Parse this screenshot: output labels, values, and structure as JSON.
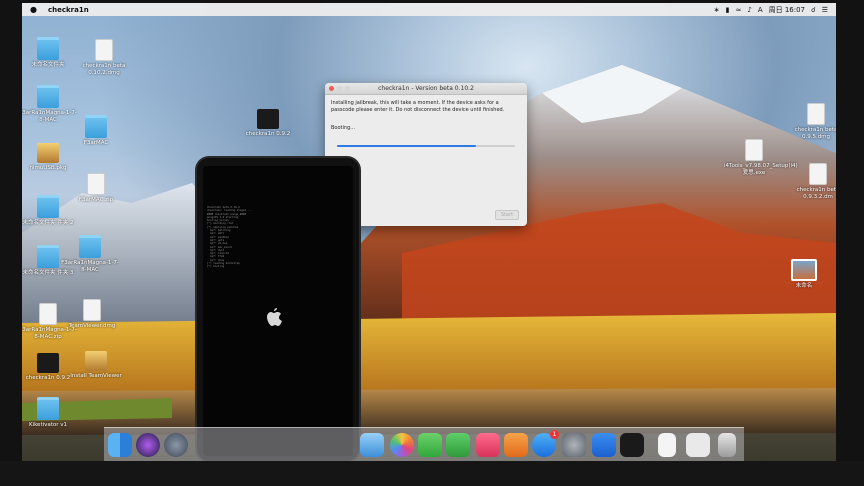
{
  "menubar": {
    "apple": "",
    "app_name": "checkra1n",
    "clock": "周日 16:07",
    "status_icons": [
      "bluetooth-icon",
      "battery-icon",
      "wifi-icon",
      "volume-icon",
      "input-source-icon"
    ]
  },
  "desktop_icons": [
    {
      "label": "未命名文件夹",
      "type": "folder"
    },
    {
      "label": "checkra1n beta 0.10.2.dmg",
      "type": "doc"
    },
    {
      "label": "F3arRa1nMagna-1-7-8-MAC",
      "type": "folder"
    },
    {
      "label": "F3arMAC",
      "type": "folder"
    },
    {
      "label": "checkra1n 0.9.2",
      "type": "app"
    },
    {
      "label": "nimuUSB.pkg",
      "type": "pkg"
    },
    {
      "label": "F3arMAC.zip",
      "type": "doc"
    },
    {
      "label": "未命名文件夹 件夹 2",
      "type": "folder"
    },
    {
      "label": "未命名文件夹 件夹 3",
      "type": "folder"
    },
    {
      "label": "F3arRa1nMagna-1-7-8-MAC",
      "type": "folder"
    },
    {
      "label": "TeamViewer.dmg",
      "type": "doc"
    },
    {
      "label": "F3arRa1nMagna-1-7-8-MAC.zip",
      "type": "doc"
    },
    {
      "label": "checkra1n 0.9.2",
      "type": "app"
    },
    {
      "label": "Install TeamViewer",
      "type": "pkg"
    },
    {
      "label": "Kiketivator v1",
      "type": "folder"
    },
    {
      "label": "checkra1n beta 0.9.5.dmg",
      "type": "doc"
    },
    {
      "label": "i4Tools_v7.98.07_Setup(i4)爱思.exe",
      "type": "doc"
    },
    {
      "label": "checkra1n beta 0.9.3.2.dm",
      "type": "doc"
    },
    {
      "label": "未命名",
      "type": "image"
    }
  ],
  "checkra1n_window": {
    "title": "checkra1n - Version beta 0.10.2",
    "message": "Installing jailbreak, this will take a moment. If the device asks for a passcode please enter it. Do not disconnect the device until finished.",
    "status": "Booting...",
    "progress": 0.78,
    "button_label": "Start"
  },
  "phone": {
    "log_lines": [
      "Checkra1n beta 0.10.2",
      "checkra1n: loading stage2 ...",
      "#### checkra1n pongo ####",
      "pongoOS 2.0 starting",
      "booting kernel ...",
      "[*] mounting root",
      "[*] applying patches",
      "  kpf: patching",
      "  kpf: amfi",
      "  kpf: sandbox",
      "  kpf: apfs",
      "  kpf: vm_map",
      "  kpf: mac_mount",
      "  kpf: dyld",
      "  kpf: launchd",
      "  kpf: tfp0",
      "  kpf: done",
      "[*] loading bootstrap",
      "[*] booting"
    ]
  },
  "dock": {
    "items": [
      "finder-icon",
      "siri-icon",
      "launchpad-icon",
      "xcode-icon",
      "photos-icon",
      "messages-icon",
      "facetime-icon",
      "music-icon",
      "books-icon",
      "app-store-icon",
      "system-preferences-icon",
      "i4-tools-icon",
      "checkra1n-icon",
      "document-icon",
      "preview-icon",
      "trash-icon"
    ],
    "app_store_badge": "1"
  },
  "colors": {
    "accent": "#2f7ae5",
    "folder_blue": "#3b9fdc"
  }
}
